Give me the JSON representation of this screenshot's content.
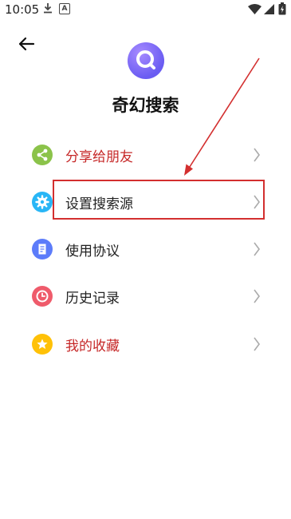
{
  "status_bar": {
    "time": "10:05",
    "notif_letter": "A"
  },
  "header": {
    "back_icon": "arrow-left-icon"
  },
  "app": {
    "title": "奇幻搜索",
    "logo_icon": "search-icon",
    "logo_color": "#6a5cf2"
  },
  "menu": {
    "items": [
      {
        "label": "分享给朋友",
        "icon": "share-icon",
        "icon_color": "#8bc34a",
        "label_color": "#c62828"
      },
      {
        "label": "设置搜索源",
        "icon": "gear-icon",
        "icon_color": "#29b6f6",
        "label_color": "#222222"
      },
      {
        "label": "使用协议",
        "icon": "document-icon",
        "icon_color": "#5c7cfa",
        "label_color": "#222222"
      },
      {
        "label": "历史记录",
        "icon": "clock-icon",
        "icon_color": "#ef5b6b",
        "label_color": "#222222"
      },
      {
        "label": "我的收藏",
        "icon": "star-icon",
        "icon_color": "#ffc107",
        "label_color": "#c62828"
      }
    ]
  },
  "annotation": {
    "color": "#d32f2f"
  }
}
